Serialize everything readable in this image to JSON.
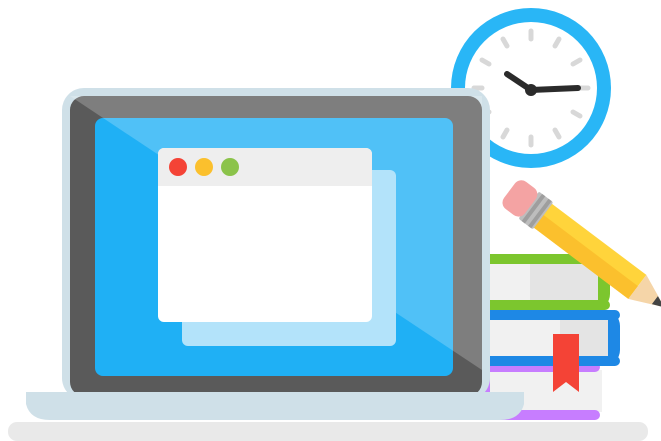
{
  "illustration": {
    "subject": "laptop-with-browser-window-clock-books-and-pencil",
    "icons": [
      "laptop-icon",
      "browser-window-icon",
      "clock-icon",
      "books-icon",
      "pencil-icon",
      "bookmark-icon"
    ],
    "colors": {
      "screen_blue": "#1FB0F5",
      "bezel_dark": "#5A5A5A",
      "laptop_base": "#CFE0E8",
      "window_white": "#FFFFFF",
      "window_bar": "#EEEEEE",
      "dot_red": "#F44336",
      "dot_yellow": "#FBC02D",
      "dot_green": "#8BC34A",
      "clock_ring": "#29B6F6",
      "book_green": "#7CC62E",
      "book_blue": "#1E88E5",
      "book_purple": "#C77DFF",
      "pencil_yellow": "#FFD43B",
      "eraser_pink": "#F4A3A3",
      "bookmark_red": "#F44336",
      "floor": "#E9E9E9"
    }
  }
}
